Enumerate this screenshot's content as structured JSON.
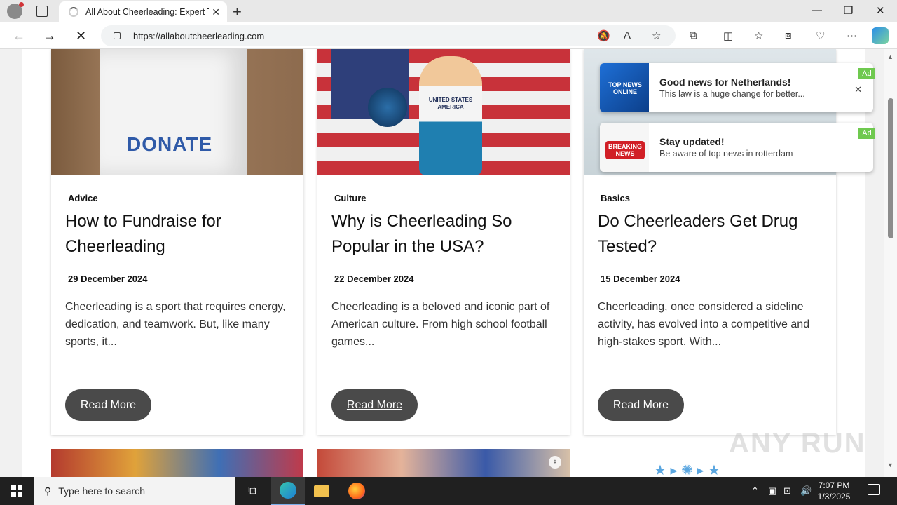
{
  "browser": {
    "tab_title": "All About Cheerleading: Expert Ti",
    "url": "https://allaboutcheerleading.com"
  },
  "cards": [
    {
      "category": "Advice",
      "title": "How to Fundraise for Cheerleading",
      "date": "29 December 2024",
      "excerpt": "Cheerleading is a sport that requires energy, dedication, and teamwork. But, like many sports, it...",
      "button": "Read More",
      "image_text": "DONATE"
    },
    {
      "category": "Culture",
      "title": "Why is Cheerleading So Popular in the USA?",
      "date": "22 December 2024",
      "excerpt": "Cheerleading is a beloved and iconic part of American culture. From high school football games...",
      "button": "Read More",
      "image_text": "UNITED STATES AMERICA"
    },
    {
      "category": "Basics",
      "title": "Do Cheerleaders Get Drug Tested?",
      "date": "15 December 2024",
      "excerpt": "Cheerleading, once considered a sideline activity, has evolved into a competitive and high-stakes sport. With...",
      "button": "Read More"
    }
  ],
  "ads": [
    {
      "thumb_text": "TOP NEWS ONLINE",
      "headline": "Good news for Netherlands!",
      "text": "This law is a huge change for better...",
      "tag": "Ad"
    },
    {
      "thumb_text": "BREAKING NEWS",
      "headline": "Stay updated!",
      "text": "Be aware of top news in rotterdam",
      "tag": "Ad"
    }
  ],
  "watermark": "ANY RUN",
  "taskbar": {
    "search_placeholder": "Type here to search",
    "time": "7:07 PM",
    "date": "1/3/2025"
  }
}
